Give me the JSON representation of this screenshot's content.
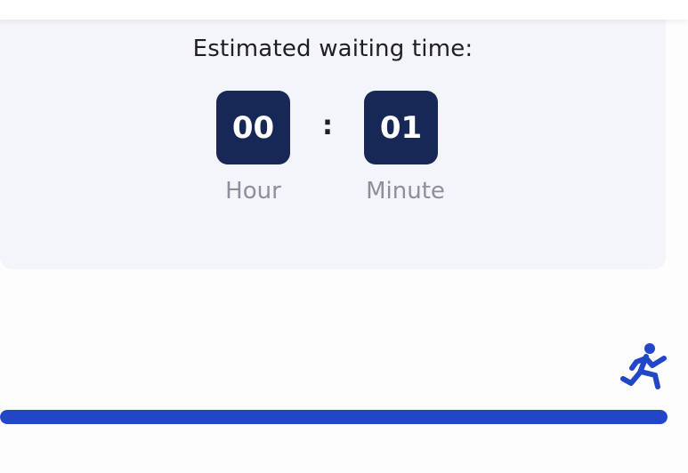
{
  "waiting": {
    "title": "Estimated waiting time:",
    "separator": ":",
    "hours": {
      "value": "00",
      "label": "Hour"
    },
    "minutes": {
      "value": "01",
      "label": "Minute"
    }
  },
  "progress": {
    "fraction": 1.0,
    "icon": "running-person-icon",
    "color": "#2146c7"
  },
  "colors": {
    "card_background": "#f4f5fa",
    "time_box": "#172856",
    "accent": "#2146c7"
  }
}
